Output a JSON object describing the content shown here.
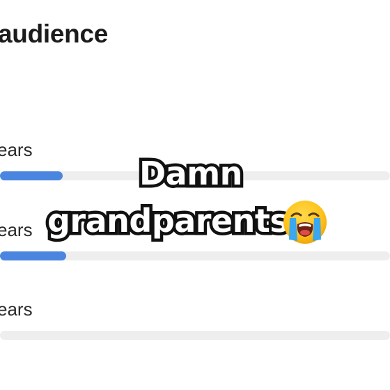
{
  "section": {
    "title": "audience"
  },
  "age_rows": [
    {
      "label": "ears",
      "share": 0.16
    },
    {
      "label": "ears",
      "share": 0.17
    },
    {
      "label": "ears",
      "share": 0
    }
  ],
  "caption": {
    "line1": "Damn",
    "line2": "grandparents",
    "emoji": "loudly-crying-face-icon"
  },
  "colors": {
    "bar_fill": "#4a86e0",
    "bar_track": "#eeeeee",
    "caption_text": "#ffffff",
    "caption_outline": "#111111"
  }
}
